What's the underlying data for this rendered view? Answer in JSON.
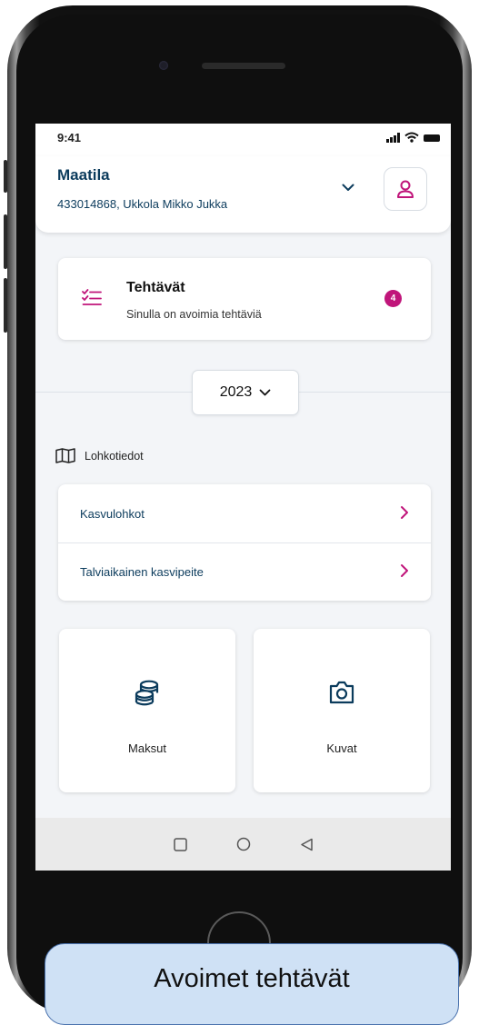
{
  "status_bar": {
    "time": "9:41"
  },
  "header": {
    "title": "Maatila",
    "subtitle": "433014868, Ukkola Mikko Jukka"
  },
  "tasks_card": {
    "title": "Tehtävät",
    "subtitle": "Sinulla on avoimia tehtäviä",
    "badge_count": "4"
  },
  "year_selector": {
    "value": "2023"
  },
  "plot_section": {
    "label": "Lohkotiedot",
    "items": [
      {
        "label": "Kasvulohkot"
      },
      {
        "label": "Talviaikainen kasvipeite"
      }
    ]
  },
  "tiles": [
    {
      "label": "Maksut",
      "icon": "coins-icon"
    },
    {
      "label": "Kuvat",
      "icon": "camera-icon"
    }
  ],
  "caption": {
    "text": "Avoimet tehtävät"
  },
  "colors": {
    "accent": "#c0157a",
    "primary_text": "#0b3b5c",
    "background": "#f3f5f8",
    "caption_bg": "#cfe1f5",
    "caption_border": "#4a72ad"
  }
}
